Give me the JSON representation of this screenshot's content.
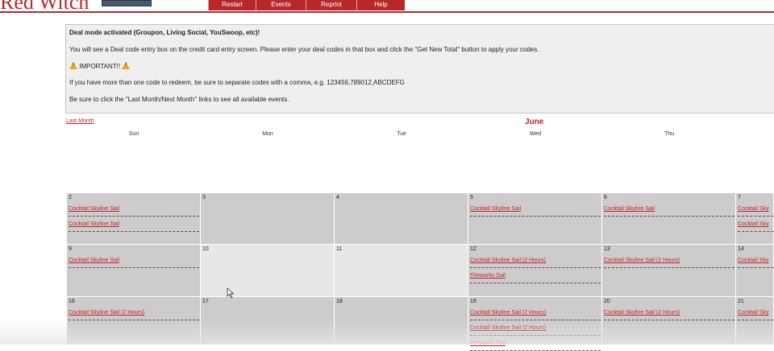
{
  "header": {
    "brand": "Red Witch",
    "nav": [
      {
        "label": "Restart"
      },
      {
        "label": "Events"
      },
      {
        "label": "Reprint"
      },
      {
        "label": "Help"
      }
    ]
  },
  "notice": {
    "title": "Deal mode activated (Groupon, Living Social, YouSwoop, etc)!",
    "line1": "You will see a Deal code entry box on the credit card entry screen. Please enter your deal codes in that box and click the \"Get New Total\" button to apply your codes.",
    "important": "IMPORTANT!!",
    "line3": "If you have more than one code to redeem, be sure to separate codes with a comma, e.g. 123456,789012,ABCDEFG",
    "line4": "Be sure to click the \"Last Month/Next Month\" links to see all available events."
  },
  "calendar": {
    "prev_link": "Last Month",
    "month": "June",
    "weekdays": [
      "Sun",
      "Mon",
      "Tue",
      "Wed",
      "Thu"
    ],
    "weeks": [
      [
        {
          "day": "2",
          "events": [
            "Cocktail Skyline Sail",
            "Cocktail Skyline Sail"
          ]
        },
        {
          "day": "3",
          "events": []
        },
        {
          "day": "4",
          "events": []
        },
        {
          "day": "5",
          "events": [
            "Cocktail Skyline Sail"
          ]
        },
        {
          "day": "6",
          "events": [
            "Cocktail Skyline Sail"
          ]
        },
        {
          "day": "7",
          "events": [
            "Cocktail Sky",
            "Cocktail Sky"
          ]
        }
      ],
      [
        {
          "day": "9",
          "events": [
            "Cocktail Skyline Sail"
          ]
        },
        {
          "day": "10",
          "events": []
        },
        {
          "day": "11",
          "events": []
        },
        {
          "day": "12",
          "events": [
            "Cocktail Skyline Sail (2 Hours)",
            "Fireworks Sail"
          ]
        },
        {
          "day": "13",
          "events": [
            "Cocktail Skyline Sail (2 Hours)"
          ]
        },
        {
          "day": "14",
          "events": [
            "Cocktail Sky"
          ]
        }
      ],
      [
        {
          "day": "16",
          "events": [
            "Cocktail Skyline Sail (2 Hours)"
          ]
        },
        {
          "day": "17",
          "events": []
        },
        {
          "day": "18",
          "events": []
        },
        {
          "day": "19",
          "events": [
            "Cocktail Skyline Sail (2 Hours)",
            "Cocktail Skyline Sail (2 Hours)",
            "Fireworks Sail"
          ]
        },
        {
          "day": "20",
          "events": [
            "Cocktail Skyline Sail (2 Hours)"
          ]
        },
        {
          "day": "21",
          "events": [
            "Cocktail Sky"
          ]
        }
      ]
    ]
  },
  "colors": {
    "accent": "#b8282b",
    "link": "#c0262b",
    "cell_gray": "#cdcbcc",
    "cell_light": "#e7e7e7"
  }
}
